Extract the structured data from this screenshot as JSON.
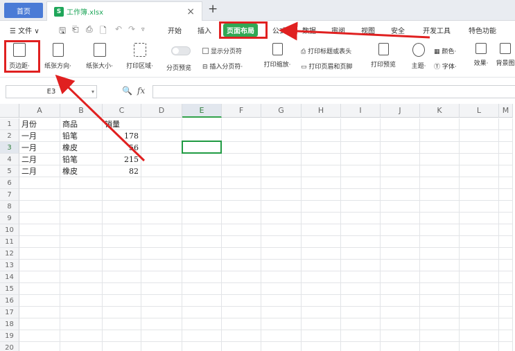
{
  "tabs": {
    "home": "首页",
    "file_icon": "S",
    "file_name": "工作簿.xlsx",
    "close": "×",
    "new": "+"
  },
  "menu": {
    "file": "☰ 文件 ∨",
    "items": [
      "开始",
      "插入",
      "页面布局",
      "公式",
      "数据",
      "审阅",
      "视图",
      "安全",
      "开发工具",
      "特色功能"
    ],
    "active": "页面布局"
  },
  "ribbon": {
    "margins": "页边距·",
    "orientation": "纸张方向·",
    "size": "纸张大小·",
    "print_area": "打印区域·",
    "page_break_preview": "分页预览",
    "show_page_break": "显示分页符",
    "insert_page_break": "插入分页符·",
    "print_scale": "打印缩放·",
    "print_titles": "打印标题或表头",
    "print_header_footer": "打印页眉和页脚",
    "print_preview": "打印预览",
    "theme": "主题·",
    "colors": "颜色·",
    "fonts": "字体·",
    "effects": "效果·",
    "background": "背景图"
  },
  "formula_bar": {
    "cell_ref": "E3",
    "fx": "fx"
  },
  "sheet": {
    "columns": [
      "A",
      "B",
      "C",
      "D",
      "E",
      "F",
      "G",
      "H",
      "I",
      "J",
      "K",
      "L",
      "M"
    ],
    "selected_column": "E",
    "selected_row": "3",
    "rows": [
      [
        "1",
        "月份",
        "商品",
        "销量"
      ],
      [
        "2",
        "一月",
        "铅笔",
        "178"
      ],
      [
        "3",
        "一月",
        "橡皮",
        "56"
      ],
      [
        "4",
        "二月",
        "铅笔",
        "215"
      ],
      [
        "5",
        "二月",
        "橡皮",
        "82"
      ],
      [
        "6",
        "",
        "",
        ""
      ],
      [
        "7",
        "",
        "",
        ""
      ],
      [
        "8",
        "",
        "",
        ""
      ],
      [
        "9",
        "",
        "",
        ""
      ],
      [
        "10",
        "",
        "",
        ""
      ],
      [
        "11",
        "",
        "",
        ""
      ],
      [
        "12",
        "",
        "",
        ""
      ],
      [
        "13",
        "",
        "",
        ""
      ],
      [
        "14",
        "",
        "",
        ""
      ],
      [
        "15",
        "",
        "",
        ""
      ],
      [
        "16",
        "",
        "",
        ""
      ],
      [
        "17",
        "",
        "",
        ""
      ],
      [
        "18",
        "",
        "",
        ""
      ],
      [
        "19",
        "",
        "",
        ""
      ],
      [
        "20",
        "",
        "",
        ""
      ]
    ]
  },
  "colors": {
    "accent_green": "#31a854",
    "annotation_red": "#e02020",
    "tab_blue": "#4a7bd6"
  }
}
